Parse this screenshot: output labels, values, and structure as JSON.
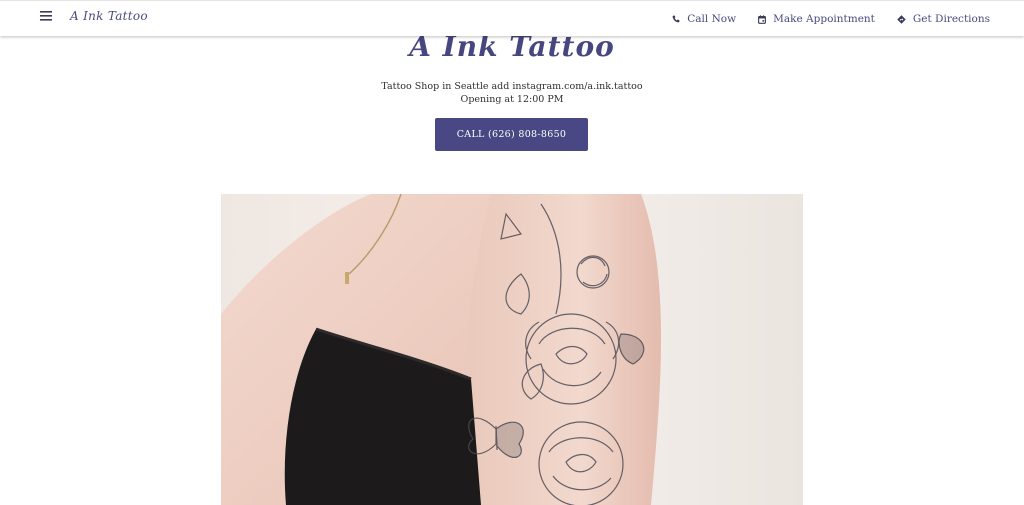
{
  "header": {
    "brand": "A Ink Tattoo",
    "nav": [
      {
        "label": "Call Now",
        "icon": "phone-icon"
      },
      {
        "label": "Make Appointment",
        "icon": "calendar-icon"
      },
      {
        "label": "Get Directions",
        "icon": "directions-icon"
      }
    ]
  },
  "hero": {
    "title": "A Ink Tattoo",
    "tagline_line1": "Tattoo Shop in Seattle add instagram.com/a.ink.tattoo",
    "tagline_line2": "Opening at 12:00 PM",
    "call_button": "CALL (626) 808-8650"
  },
  "theme": {
    "accent": "#4a4884",
    "nav_text": "#4a4a80",
    "body_text": "#2f2f2f"
  },
  "image": {
    "icon": "tattoo-photo"
  }
}
